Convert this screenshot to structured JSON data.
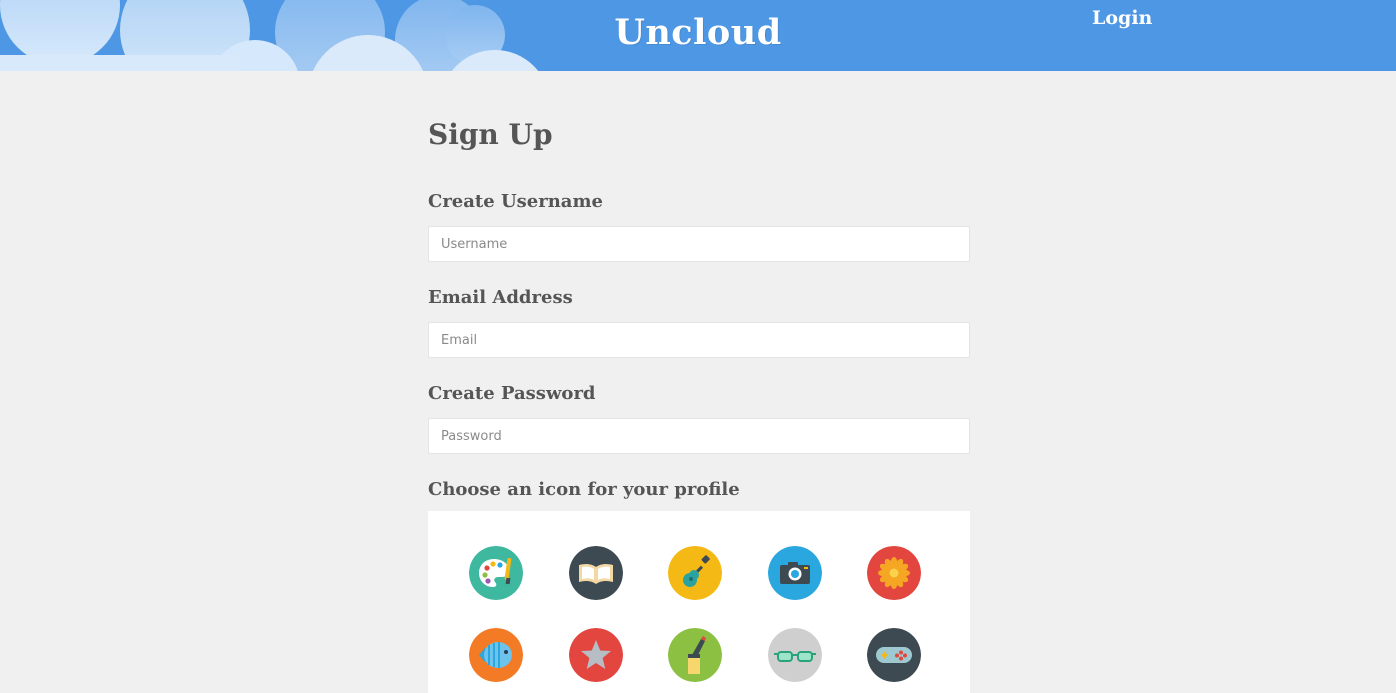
{
  "header": {
    "brand": "Uncloud",
    "login_label": "Login",
    "background_color": "#4d97e4"
  },
  "signup": {
    "title": "Sign Up",
    "username_label": "Create Username",
    "username_placeholder": "Username",
    "email_label": "Email Address",
    "email_placeholder": "Email",
    "password_label": "Create Password",
    "password_placeholder": "Password",
    "icon_label": "Choose an icon for your profile"
  },
  "profile_icons": [
    {
      "name": "palette-icon",
      "color": "#3fb8a0"
    },
    {
      "name": "book-icon",
      "color": "#3d4a52"
    },
    {
      "name": "guitar-icon",
      "color": "#f5b915"
    },
    {
      "name": "camera-icon",
      "color": "#29a7de"
    },
    {
      "name": "flower-icon",
      "color": "#e2463f"
    },
    {
      "name": "fish-icon",
      "color": "#f47b26"
    },
    {
      "name": "star-icon",
      "color": "#e2463f"
    },
    {
      "name": "pen-icon",
      "color": "#8cc043"
    },
    {
      "name": "glasses-icon",
      "color": "#cfcfcf"
    },
    {
      "name": "gamepad-icon",
      "color": "#3d4a52"
    }
  ]
}
